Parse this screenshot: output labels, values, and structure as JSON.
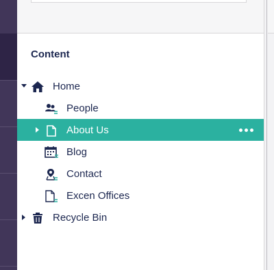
{
  "section": {
    "title": "Content"
  },
  "tree": {
    "home": {
      "label": "Home",
      "icon": "home-icon"
    },
    "items": [
      {
        "label": "People",
        "icon": "people-icon"
      },
      {
        "label": "About Us",
        "icon": "document-icon",
        "selected": true
      },
      {
        "label": "Blog",
        "icon": "calendar-icon"
      },
      {
        "label": "Contact",
        "icon": "map-pin-icon"
      },
      {
        "label": "Excen Offices",
        "icon": "document-icon"
      }
    ],
    "recycle_bin": {
      "label": "Recycle Bin",
      "icon": "trash-icon"
    }
  },
  "colors": {
    "sidebar": "#413659",
    "selected_row": "#2bb1a0",
    "text": "#1b264f"
  }
}
